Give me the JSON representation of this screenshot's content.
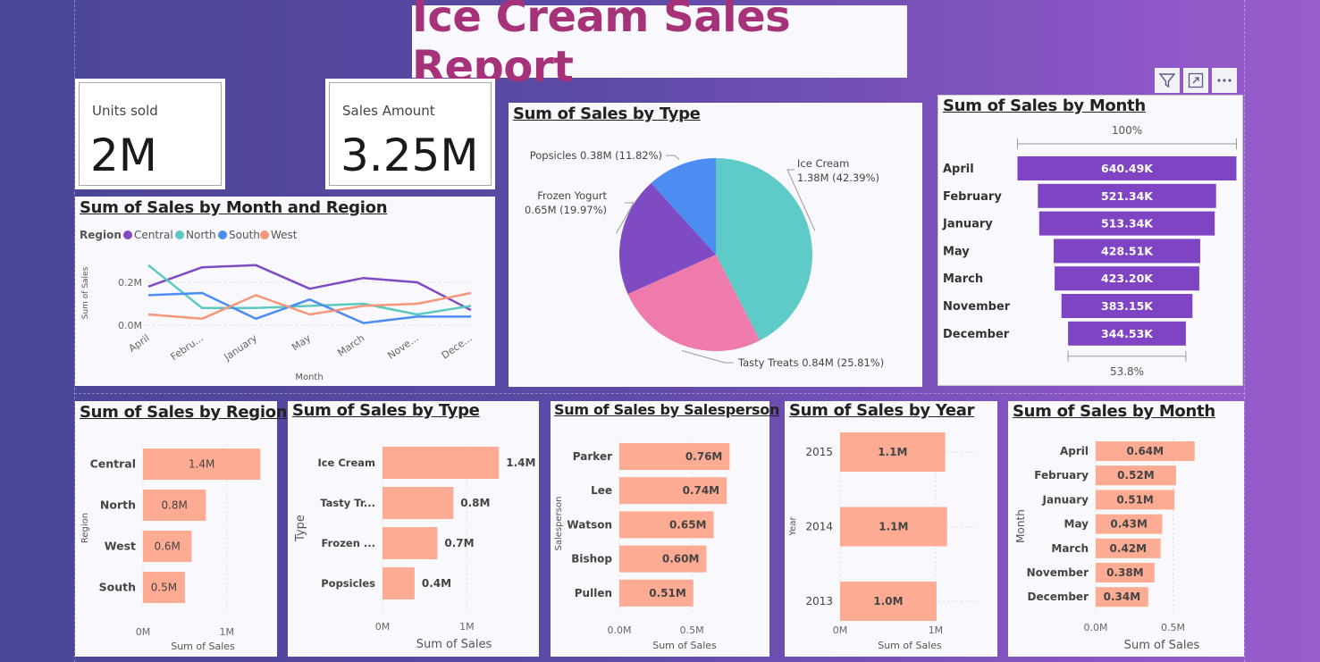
{
  "report_title": "Ice Cream Sales Report",
  "kpis": [
    {
      "label": "Units sold",
      "value": "2M"
    },
    {
      "label": "Sales Amount",
      "value": "3.25M"
    }
  ],
  "colors": {
    "title": "#a6337a",
    "bar_salmon": "#fdab92",
    "funnel_purple": "#7e44c4",
    "central": "#7e4bc2",
    "north": "#5bc9c2",
    "south": "#4b8df2",
    "west": "#f7977a"
  },
  "toolbar_icons": [
    "filter-icon",
    "focus-mode-icon",
    "more-options-icon"
  ],
  "chart_data": [
    {
      "id": "line_month_region",
      "type": "line",
      "title": "Sum of Sales by Month and Region",
      "legend_title": "Region",
      "legend_placement": "top-left",
      "xlabel": "Month",
      "ylabel": "Sum of Sales",
      "x_labels": [
        "April",
        "February",
        "January",
        "May",
        "March",
        "November",
        "December"
      ],
      "x_tick_labels": [
        "April",
        "Febru...",
        "January",
        "May",
        "March",
        "Nove...",
        "Dece..."
      ],
      "y_ticks": [
        "0.0M",
        "0.2M"
      ],
      "ylim": [
        0,
        0.3
      ],
      "series": [
        {
          "name": "Central",
          "color": "#7e4bc2",
          "values": [
            0.18,
            0.27,
            0.28,
            0.17,
            0.22,
            0.2,
            0.07
          ]
        },
        {
          "name": "North",
          "color": "#5bc9c2",
          "values": [
            0.28,
            0.08,
            0.08,
            0.09,
            0.1,
            0.05,
            0.09
          ]
        },
        {
          "name": "South",
          "color": "#4b8df2",
          "values": [
            0.14,
            0.15,
            0.03,
            0.12,
            0.01,
            0.04,
            0.04
          ]
        },
        {
          "name": "West",
          "color": "#f7977a",
          "values": [
            0.05,
            0.03,
            0.14,
            0.05,
            0.09,
            0.1,
            0.15
          ]
        }
      ]
    },
    {
      "id": "pie_type",
      "type": "pie",
      "title": "Sum of Sales by Type",
      "slices": [
        {
          "name": "Ice Cream",
          "value": 1.38,
          "pct": 42.39,
          "color": "#5ecbc8",
          "label1": "Ice Cream",
          "label2": "1.38M (42.39%)"
        },
        {
          "name": "Tasty Treats",
          "value": 0.84,
          "pct": 25.81,
          "color": "#ef7bac",
          "label1": "Tasty Treats 0.84M (25.81%)",
          "label2": ""
        },
        {
          "name": "Frozen Yogurt",
          "value": 0.65,
          "pct": 19.97,
          "color": "#7e4bc2",
          "label1": "Frozen Yogurt",
          "label2": "0.65M (19.97%)"
        },
        {
          "name": "Popsicles",
          "value": 0.38,
          "pct": 11.82,
          "color": "#4b8df2",
          "label1": "Popsicles 0.38M (11.82%)",
          "label2": ""
        }
      ]
    },
    {
      "id": "funnel_month",
      "type": "bar",
      "subtype": "funnel",
      "title": "Sum of Sales by Month",
      "top_pct_label": "100%",
      "bottom_pct_label": "53.8%",
      "categories": [
        "April",
        "February",
        "January",
        "May",
        "March",
        "November",
        "December"
      ],
      "values": [
        640.49,
        521.34,
        513.34,
        428.51,
        423.2,
        383.15,
        344.53
      ],
      "value_labels": [
        "640.49K",
        "521.34K",
        "513.34K",
        "428.51K",
        "423.20K",
        "383.15K",
        "344.53K"
      ]
    },
    {
      "id": "bar_region",
      "type": "bar",
      "title": "Sum of Sales by Region",
      "xlabel": "Sum of Sales",
      "ylabel": "Region",
      "categories": [
        "Central",
        "North",
        "West",
        "South"
      ],
      "values": [
        1.4,
        0.75,
        0.58,
        0.5
      ],
      "value_labels": [
        "1.4M",
        "0.8M",
        "0.6M",
        "0.5M"
      ],
      "x_ticks": [
        "0M",
        "1M"
      ],
      "xlim": [
        0,
        1.6
      ]
    },
    {
      "id": "bar_type",
      "type": "bar",
      "title": "Sum of Sales by Type",
      "xlabel": "Sum of Sales",
      "ylabel": "Type",
      "categories": [
        "Ice Cream",
        "Tasty Tr...",
        "Frozen ...",
        "Popsicles"
      ],
      "values": [
        1.38,
        0.84,
        0.65,
        0.38
      ],
      "value_labels": [
        "1.4M",
        "0.8M",
        "0.7M",
        "0.4M"
      ],
      "x_ticks": [
        "0M",
        "1M"
      ],
      "xlim": [
        0,
        1.6
      ]
    },
    {
      "id": "bar_salesperson",
      "type": "bar",
      "title": "Sum of Sales by Salesperson",
      "xlabel": "Sum of Sales",
      "ylabel": "Salesperson",
      "categories": [
        "Parker",
        "Lee",
        "Watson",
        "Bishop",
        "Pullen"
      ],
      "values": [
        0.76,
        0.74,
        0.65,
        0.6,
        0.51
      ],
      "value_labels": [
        "0.76M",
        "0.74M",
        "0.65M",
        "0.60M",
        "0.51M"
      ],
      "x_ticks": [
        "0.0M",
        "0.5M"
      ],
      "xlim": [
        0,
        0.85
      ]
    },
    {
      "id": "bar_year",
      "type": "bar",
      "title": "Sum of Sales by Year",
      "xlabel": "Sum of Sales",
      "ylabel": "Year",
      "categories": [
        "2015",
        "2014",
        "2013"
      ],
      "values": [
        1.1,
        1.12,
        1.01
      ],
      "value_labels": [
        "1.1M",
        "1.1M",
        "1.0M"
      ],
      "x_ticks": [
        "0M",
        "1M"
      ],
      "xlim": [
        0,
        1.45
      ]
    },
    {
      "id": "bar_month",
      "type": "bar",
      "title": "Sum of Sales by Month",
      "xlabel": "Sum of Sales",
      "ylabel": "Month",
      "categories": [
        "April",
        "February",
        "January",
        "May",
        "March",
        "November",
        "December"
      ],
      "values": [
        0.64,
        0.52,
        0.51,
        0.43,
        0.42,
        0.38,
        0.34
      ],
      "value_labels": [
        "0.64M",
        "0.52M",
        "0.51M",
        "0.43M",
        "0.42M",
        "0.38M",
        "0.34M"
      ],
      "x_ticks": [
        "0.0M",
        "0.5M"
      ],
      "xlim": [
        0,
        0.85
      ]
    }
  ]
}
